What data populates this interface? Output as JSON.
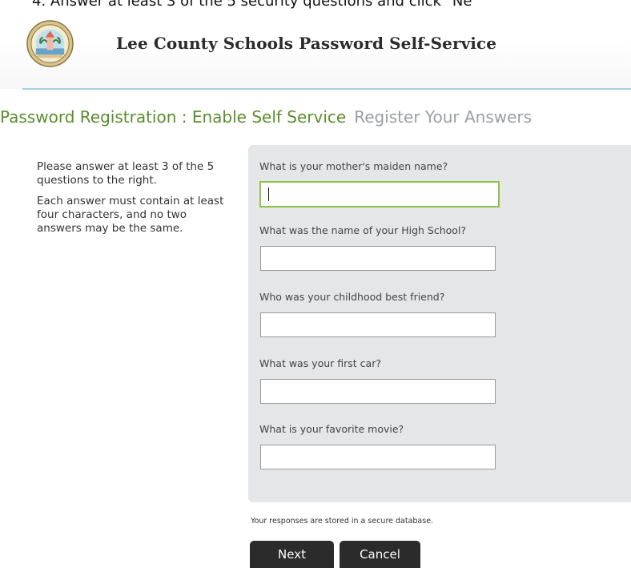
{
  "instruction_banner": "4.   Answer at least 3 of the 5 security questions and click \"Ne",
  "header": {
    "title": "Lee County Schools Password Self-Service",
    "seal_icon": "school-district-seal-icon"
  },
  "heading": {
    "prefix": "Password Registration : ",
    "current_step": "Enable Self Service",
    "next_step": "Register Your Answers"
  },
  "instructions": {
    "paragraph1": "Please answer at least 3 of the 5 questions to the right.",
    "paragraph2": "Each answer must contain at least four characters, and no two answers may be the same."
  },
  "questions": [
    {
      "label": "What is your mother's maiden name?",
      "value": "",
      "focused": true
    },
    {
      "label": "What was the name of your High School?",
      "value": "",
      "focused": false
    },
    {
      "label": "Who was your childhood best friend?",
      "value": "",
      "focused": false
    },
    {
      "label": "What was your first car?",
      "value": "",
      "focused": false
    },
    {
      "label": "What is your favorite movie?",
      "value": "",
      "focused": false
    }
  ],
  "footer": {
    "secure_note": "Your responses are stored in a secure database.",
    "next_label": "Next",
    "cancel_label": "Cancel"
  },
  "colors": {
    "accent_green": "#5b8e2b",
    "focus_border": "#8bc34a",
    "header_rule": "#a6d3df",
    "panel_bg": "#e4e6e8",
    "button_bg": "#2b2b2b"
  }
}
